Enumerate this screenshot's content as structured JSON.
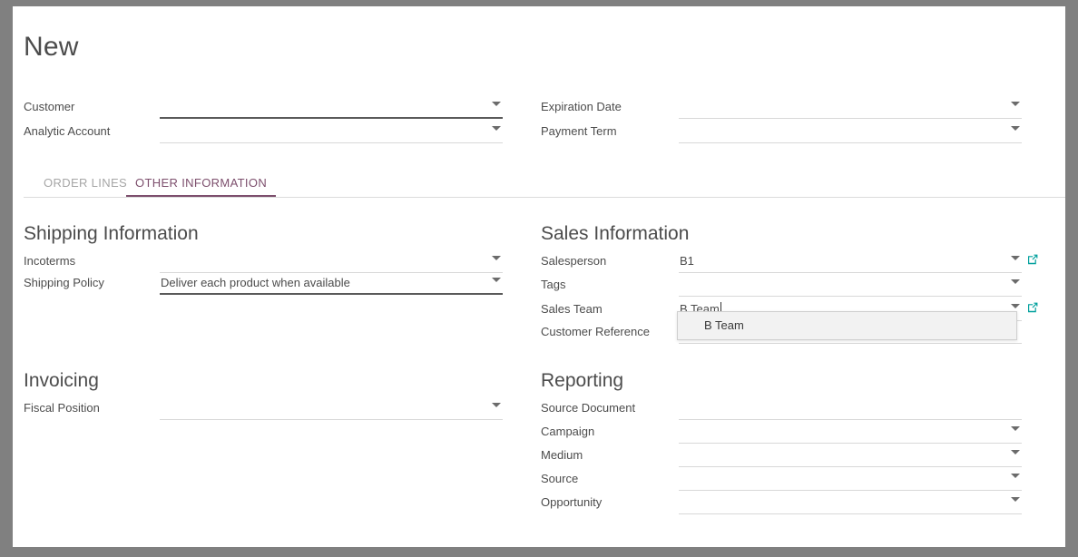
{
  "page": {
    "title": "New"
  },
  "header_fields": {
    "left": [
      {
        "label": "Customer",
        "value": "",
        "placeholder": "",
        "has_dropdown": true,
        "required": true
      },
      {
        "label": "Analytic Account",
        "value": "",
        "placeholder": "",
        "has_dropdown": true,
        "required": false
      }
    ],
    "right": [
      {
        "label": "Expiration Date",
        "value": "",
        "placeholder": "",
        "has_dropdown": true,
        "required": false
      },
      {
        "label": "Payment Term",
        "value": "",
        "placeholder": "",
        "has_dropdown": true,
        "required": false
      }
    ]
  },
  "tabs": [
    {
      "label": "ORDER LINES",
      "active": false
    },
    {
      "label": "OTHER INFORMATION",
      "active": true
    }
  ],
  "groups": {
    "shipping": {
      "title": "Shipping Information",
      "fields": [
        {
          "label": "Incoterms",
          "value": "",
          "has_dropdown": true,
          "required": false
        },
        {
          "label": "Shipping Policy",
          "value": "Deliver each product when available",
          "has_dropdown": true,
          "required": true
        }
      ]
    },
    "sales": {
      "title": "Sales Information",
      "fields": [
        {
          "label": "Salesperson",
          "value": "B1",
          "has_dropdown": true,
          "external_link": true,
          "required": false
        },
        {
          "label": "Tags",
          "value": "",
          "has_dropdown": true,
          "external_link": false,
          "required": false
        },
        {
          "label": "Sales Team",
          "value": "B Team",
          "has_dropdown": true,
          "external_link": true,
          "required": false,
          "focused": true
        },
        {
          "label": "Customer Reference",
          "value": "",
          "has_dropdown": false,
          "external_link": false,
          "required": false
        }
      ]
    },
    "invoicing": {
      "title": "Invoicing",
      "fields": [
        {
          "label": "Fiscal Position",
          "value": "",
          "has_dropdown": true,
          "required": false
        }
      ]
    },
    "reporting": {
      "title": "Reporting",
      "fields": [
        {
          "label": "Source Document",
          "value": "",
          "has_dropdown": false,
          "required": false
        },
        {
          "label": "Campaign",
          "value": "",
          "has_dropdown": true,
          "required": false
        },
        {
          "label": "Medium",
          "value": "",
          "has_dropdown": true,
          "required": false
        },
        {
          "label": "Source",
          "value": "",
          "has_dropdown": true,
          "required": false
        },
        {
          "label": "Opportunity",
          "value": "",
          "has_dropdown": true,
          "required": false
        }
      ]
    }
  },
  "autocomplete": {
    "visible": true,
    "for_field": "Sales Team",
    "options": [
      {
        "label": "B Team"
      }
    ]
  },
  "icons": {
    "dropdown": "chevron-down-icon",
    "external_link": "external-link-icon"
  },
  "colors": {
    "accent_tab": "#7d4f6d",
    "external_link": "#00a09d",
    "text": "#4c4c4c",
    "muted_text": "#a6a6a6",
    "underline": "#d8d8d8",
    "underline_strong": "#5a5a5a",
    "frame": "#808080",
    "sheet": "#ffffff"
  }
}
